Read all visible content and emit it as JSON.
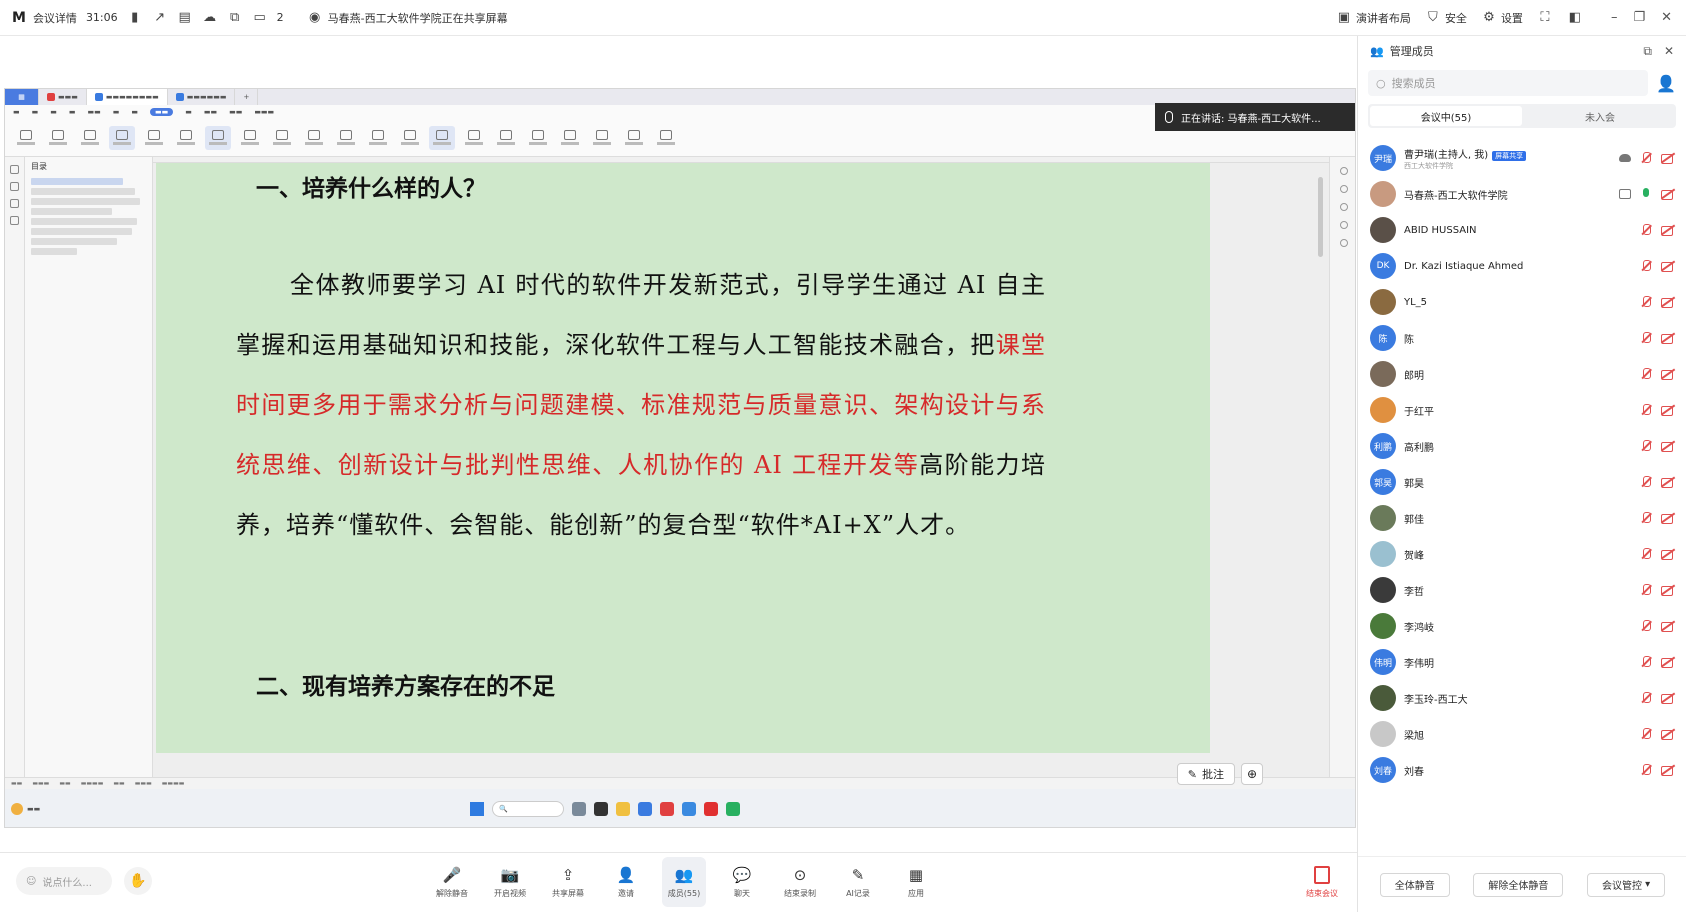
{
  "topbar": {
    "meeting_info": "会议详情",
    "timer": "31:06",
    "sharing_count": "2",
    "share_status": "马春燕-西工大软件学院正在共享屏幕",
    "layout_label": "演讲者布局",
    "security_label": "安全",
    "settings_label": "设置"
  },
  "shared_screen": {
    "speaking_label": "正在讲话: 马春燕-西工大软件...",
    "document": {
      "heading1": "一、培养什么样的人？",
      "para_part1": "全体教师要学习 AI 时代的软件开发新范式，引导学生通过 AI 自主掌握和运用基础知识和技能，深化软件工程与人工智能技术融合，把",
      "para_red": "课堂时间更多用于需求分析与问题建模、标准规范与质量意识、架构设计与系统思维、创新设计与批判性思维、人机协作的 AI 工程开发等",
      "para_part2": "高阶能力培养，培养“懂软件、会智能、能创新”的复合型“软件*AI+X”人才。",
      "heading2": "二、现有培养方案存在的不足"
    },
    "toc_title": "目录",
    "annotate_label": "批注"
  },
  "panel": {
    "title": "管理成员",
    "search_placeholder": "搜索成员",
    "tab_in_meeting": "会议中(55)",
    "tab_not_joined": "未入会",
    "members": [
      {
        "name": "曹尹瑞(主持人, 我)",
        "sub": "西工大软件学院",
        "tag": "屏幕共享",
        "avatar_text": "尹瑞",
        "avatar_color": "#3a7be0",
        "status": "cloud"
      },
      {
        "name": "马春燕-西工大软件学院",
        "avatar_text": "",
        "avatar_color": "#c89a80",
        "status": "speaking"
      },
      {
        "name": "ABID HUSSAIN",
        "avatar_text": "",
        "avatar_color": "#5a5048",
        "status": "muted"
      },
      {
        "name": "Dr. Kazi Istiaque Ahmed",
        "avatar_text": "DK",
        "avatar_color": "#3a7be0",
        "status": "muted"
      },
      {
        "name": "YL_5",
        "avatar_text": "",
        "avatar_color": "#8a6a40",
        "status": "muted"
      },
      {
        "name": "陈",
        "avatar_text": "陈",
        "avatar_color": "#3a7be0",
        "status": "muted"
      },
      {
        "name": "郎明",
        "avatar_text": "",
        "avatar_color": "#7a6a5a",
        "status": "muted"
      },
      {
        "name": "于红平",
        "avatar_text": "",
        "avatar_color": "#e09040",
        "status": "muted"
      },
      {
        "name": "高利鹏",
        "avatar_text": "利鹏",
        "avatar_color": "#3a7be0",
        "status": "muted"
      },
      {
        "name": "郭昊",
        "avatar_text": "郭昊",
        "avatar_color": "#3a7be0",
        "status": "muted"
      },
      {
        "name": "郭佳",
        "avatar_text": "",
        "avatar_color": "#6a7a5a",
        "status": "muted"
      },
      {
        "name": "贺峰",
        "avatar_text": "",
        "avatar_color": "#9ac0d0",
        "status": "muted"
      },
      {
        "name": "李哲",
        "avatar_text": "",
        "avatar_color": "#3a3a3a",
        "status": "muted"
      },
      {
        "name": "李鸿岐",
        "avatar_text": "",
        "avatar_color": "#4a7a3a",
        "status": "muted"
      },
      {
        "name": "李伟明",
        "avatar_text": "伟明",
        "avatar_color": "#3a7be0",
        "status": "muted"
      },
      {
        "name": "李玉玲-西工大",
        "avatar_text": "",
        "avatar_color": "#4a5a3a",
        "status": "muted"
      },
      {
        "name": "梁旭",
        "avatar_text": "",
        "avatar_color": "#c8c8c8",
        "status": "muted"
      },
      {
        "name": "刘春",
        "avatar_text": "刘春",
        "avatar_color": "#3a7be0",
        "status": "muted"
      }
    ],
    "footer": {
      "mute_all": "全体静音",
      "unmute_all": "解除全体静音",
      "meeting_control": "会议管控"
    }
  },
  "bottombar": {
    "chat_placeholder": "说点什么...",
    "tools": [
      {
        "label": "解除静音",
        "icon": "mic-icon"
      },
      {
        "label": "开启视频",
        "icon": "camera-icon"
      },
      {
        "label": "共享屏幕",
        "icon": "share-screen-icon"
      },
      {
        "label": "邀请",
        "icon": "invite-icon"
      },
      {
        "label": "成员(55)",
        "icon": "members-icon"
      },
      {
        "label": "聊天",
        "icon": "chat-icon"
      },
      {
        "label": "结束录制",
        "icon": "record-icon"
      },
      {
        "label": "AI记录",
        "icon": "ai-icon"
      },
      {
        "label": "应用",
        "icon": "apps-icon"
      }
    ],
    "end_label": "结束会议"
  },
  "colors": {
    "accent": "#3a7be0",
    "doc_background": "#cfe8cb",
    "highlight_red": "#d62a2a",
    "muted_red": "#e05050"
  }
}
